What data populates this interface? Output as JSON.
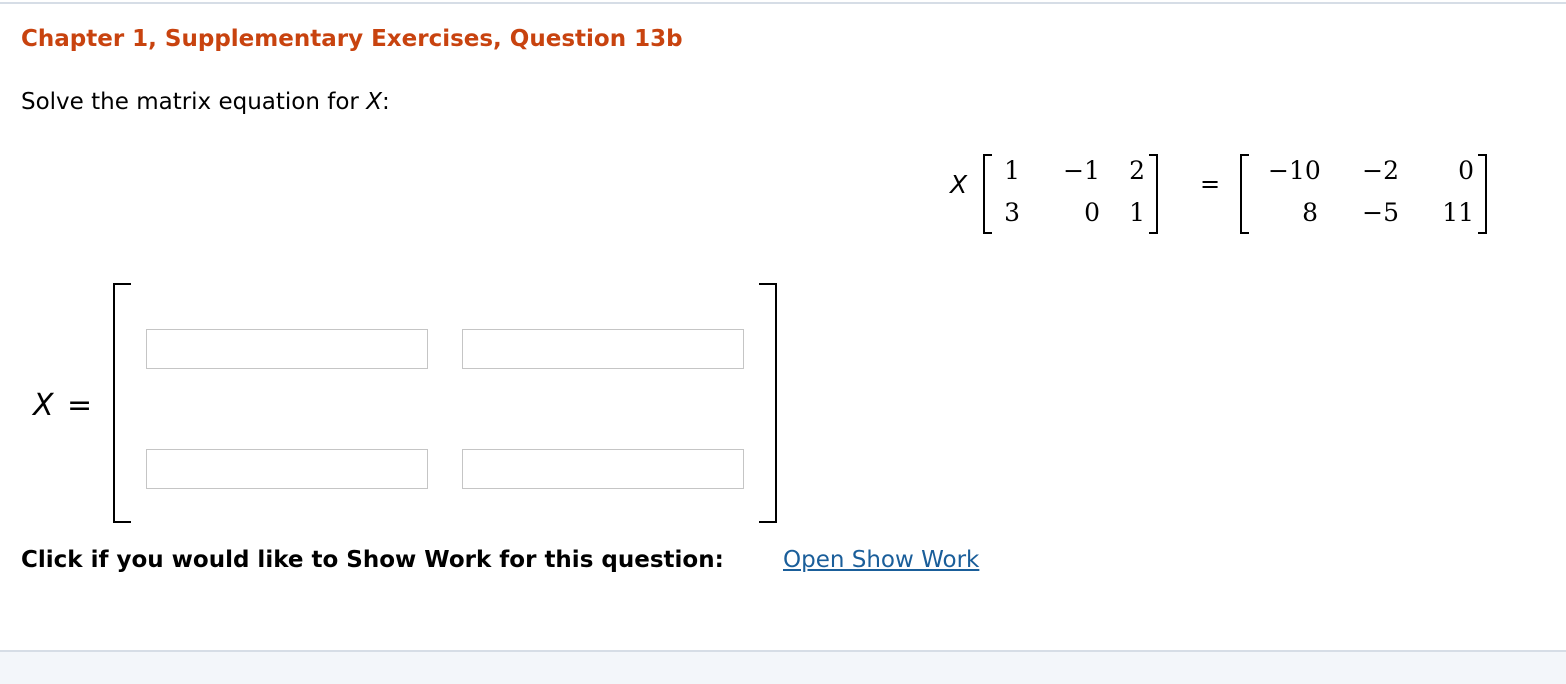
{
  "header": {
    "title": "Chapter 1, Supplementary Exercises, Question 13b"
  },
  "prompt": {
    "text": "Solve the matrix equation for ",
    "variable": "X",
    "suffix": ":"
  },
  "equation": {
    "lhs_var": "X",
    "lhs_matrix": [
      [
        "1",
        "−1",
        "2"
      ],
      [
        "3",
        "0",
        "1"
      ]
    ],
    "equals": "=",
    "rhs_matrix": [
      [
        "−10",
        "−2",
        "0"
      ],
      [
        "8",
        "−5",
        "11"
      ]
    ]
  },
  "answer": {
    "variable": "X",
    "equals": "=",
    "cells": [
      [
        "",
        ""
      ],
      [
        "",
        ""
      ]
    ]
  },
  "show_work": {
    "label": "Click if you would like to Show Work for this question:",
    "link": "Open Show Work"
  },
  "colors": {
    "title": "#c8430f",
    "link": "#1a5e9a",
    "rule": "#d6dde6"
  }
}
